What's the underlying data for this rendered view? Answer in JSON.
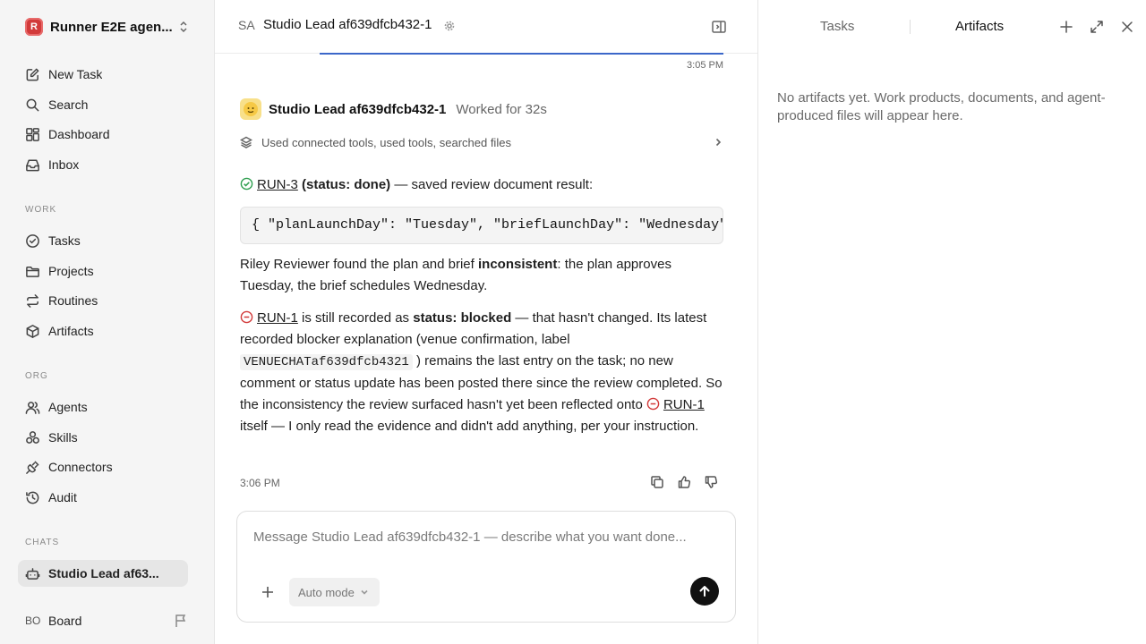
{
  "sidebar": {
    "workspace": {
      "logo_text": "R",
      "name": "Runner E2E agen..."
    },
    "top_items": [
      {
        "label": "New Task",
        "icon": "edit-icon"
      },
      {
        "label": "Search",
        "icon": "search-icon"
      },
      {
        "label": "Dashboard",
        "icon": "dashboard-icon"
      },
      {
        "label": "Inbox",
        "icon": "inbox-icon"
      }
    ],
    "sections": {
      "work": "WORK",
      "org": "ORG",
      "chats": "CHATS"
    },
    "work_items": [
      {
        "label": "Tasks",
        "icon": "check-circle-icon"
      },
      {
        "label": "Projects",
        "icon": "folder-icon"
      },
      {
        "label": "Routines",
        "icon": "repeat-icon"
      },
      {
        "label": "Artifacts",
        "icon": "cube-icon"
      }
    ],
    "org_items": [
      {
        "label": "Agents",
        "icon": "users-icon"
      },
      {
        "label": "Skills",
        "icon": "skills-icon"
      },
      {
        "label": "Connectors",
        "icon": "plug-icon"
      },
      {
        "label": "Audit",
        "icon": "history-icon"
      }
    ],
    "chat_items": [
      {
        "label": "Studio Lead af63...",
        "icon": "bot-icon",
        "active": true
      }
    ],
    "board": {
      "initials": "BO",
      "label": "Board"
    }
  },
  "header": {
    "initials": "SA",
    "title": "Studio Lead af639dfcb432-1"
  },
  "conversation": {
    "prev_time": "3:05 PM",
    "message": {
      "author": "Studio Lead af639dfcb432-1",
      "worked": "Worked for 32s",
      "tools_summary": "Used connected tools, used tools, searched files",
      "p1_link": "RUN-3",
      "p1_bold": "(status: done)",
      "p1_rest": " — saved review document result:",
      "code": "{ \"planLaunchDay\": \"Tuesday\", \"briefLaunchDay\": \"Wednesday\" }",
      "p2_a": "Riley Reviewer found the plan and brief ",
      "p2_bold": "inconsistent",
      "p2_b": ": the plan approves Tuesday, the brief schedules Wednesday.",
      "p3_link": "RUN-1",
      "p3_a": " is still recorded as ",
      "p3_bold": "status: blocked",
      "p3_b": " — that hasn't changed. Its latest recorded blocker explanation (venue confirmation, label ",
      "p3_code": "VENUECHATaf639dfcb4321",
      "p3_c": " ) remains the last entry on the task; no new comment or status update has been posted there since the review completed. So the inconsistency the review surfaced hasn't yet been reflected onto ",
      "p3_link2": "RUN-1",
      "p3_d": " itself — I only read the evidence and didn't add anything, per your instruction.",
      "time": "3:06 PM"
    }
  },
  "composer": {
    "placeholder": "Message Studio Lead af639dfcb432-1 — describe what you want done...",
    "mode": "Auto mode"
  },
  "right_panel": {
    "tabs": [
      "Tasks",
      "Artifacts"
    ],
    "active_tab": "Artifacts",
    "empty_text": "No artifacts yet. Work products, documents, and agent-produced files will appear here."
  },
  "colors": {
    "accent_line": "#3b67c9",
    "done_green": "#2e9e4f",
    "blocked_red": "#d23a3a",
    "workspace_logo": "#d23a3a"
  }
}
